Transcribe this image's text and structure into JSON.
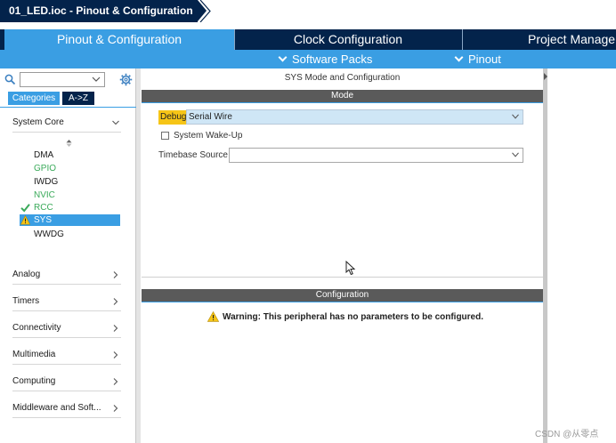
{
  "window": {
    "title": "01_LED.ioc - Pinout & Configuration"
  },
  "tabs": [
    {
      "label": "Pinout & Configuration",
      "active": true
    },
    {
      "label": "Clock Configuration",
      "active": false
    },
    {
      "label": "Project Manage",
      "active": false
    }
  ],
  "subbar": {
    "software_packs": "Software Packs",
    "pinout": "Pinout"
  },
  "sidebar": {
    "search_value": "",
    "categories_label": "Categories",
    "az_label": "A->Z",
    "system_core": {
      "label": "System Core",
      "items": [
        {
          "label": "DMA",
          "status": "normal"
        },
        {
          "label": "GPIO",
          "status": "green"
        },
        {
          "label": "IWDG",
          "status": "normal"
        },
        {
          "label": "NVIC",
          "status": "green"
        },
        {
          "label": "RCC",
          "status": "check"
        },
        {
          "label": "SYS",
          "status": "warning-selected"
        },
        {
          "label": "WWDG",
          "status": "normal"
        }
      ]
    },
    "groups": [
      {
        "label": "Analog"
      },
      {
        "label": "Timers"
      },
      {
        "label": "Connectivity"
      },
      {
        "label": "Multimedia"
      },
      {
        "label": "Computing"
      },
      {
        "label": "Middleware and Soft..."
      }
    ]
  },
  "main": {
    "title": "SYS Mode and Configuration",
    "mode_header": "Mode",
    "debug_label": "Debug",
    "debug_value": "Serial Wire",
    "wakeup_label": "System Wake-Up",
    "wakeup_checked": false,
    "timebase_label": "Timebase Source",
    "timebase_value": "",
    "config_header": "Configuration",
    "warning_text": "Warning: This peripheral has no parameters to be configured."
  },
  "watermark": "CSDN @从零点",
  "colors": {
    "navy": "#03234b",
    "accent_blue": "#3a9ee3",
    "enabled_green": "#3aaa5a",
    "warning_yellow": "#f6c517",
    "section_gray": "#5a5a5a"
  },
  "icons": {
    "search": "search-icon",
    "settings": "gear-icon",
    "check": "check-icon",
    "warning": "warning-icon",
    "chevron": "chevron-down-icon"
  }
}
